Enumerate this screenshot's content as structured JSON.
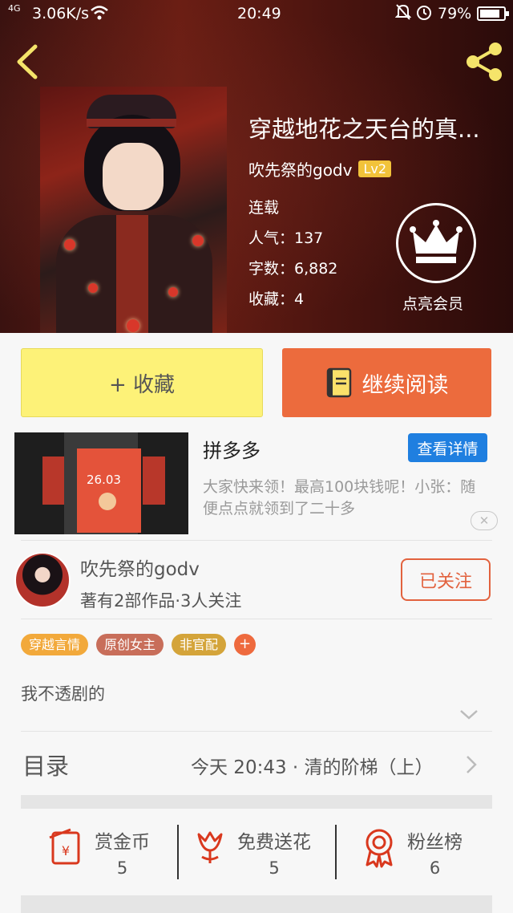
{
  "status_bar": {
    "signal": "4G",
    "speed": "3.06K/s",
    "time": "20:49",
    "battery": "79%"
  },
  "book": {
    "title": "穿越地花之天台的真...",
    "author": "吹先祭的godv",
    "level": "Lv2",
    "status": "连载",
    "popularity": "人气：137",
    "word_count": "字数：6,882",
    "favorites": "收藏：4",
    "vip_label": "点亮会员"
  },
  "actions": {
    "favorite": "+ 收藏",
    "continue_read": "继续阅读"
  },
  "ad": {
    "title": "拼多多",
    "button": "查看详情",
    "description": "大家快来领！最高100块钱呢！小张：随便点点就领到了二十多",
    "amount": "26.03",
    "close": "✕"
  },
  "author_card": {
    "name": "吹先祭的godv",
    "meta": "著有2部作品·3人关注",
    "follow": "已关注"
  },
  "tags": [
    {
      "label": "穿越言情",
      "color": "#f2a93b"
    },
    {
      "label": "原创女主",
      "color": "#c86e5a"
    },
    {
      "label": "非官配",
      "color": "#d4a43a"
    }
  ],
  "tag_add": "+",
  "summary": "我不透剧的",
  "catalog": {
    "label": "目录",
    "latest": "今天 20:43 · 清的阶梯（上）"
  },
  "bottom_stats": [
    {
      "label": "赏金币",
      "value": "5"
    },
    {
      "label": "免费送花",
      "value": "5"
    },
    {
      "label": "粉丝榜",
      "value": "6"
    }
  ],
  "colors": {
    "accent": "#ec6b3d",
    "fav_yellow": "#fdf278",
    "ad_blue": "#1f7fe0",
    "icon_red": "#d9381e"
  }
}
